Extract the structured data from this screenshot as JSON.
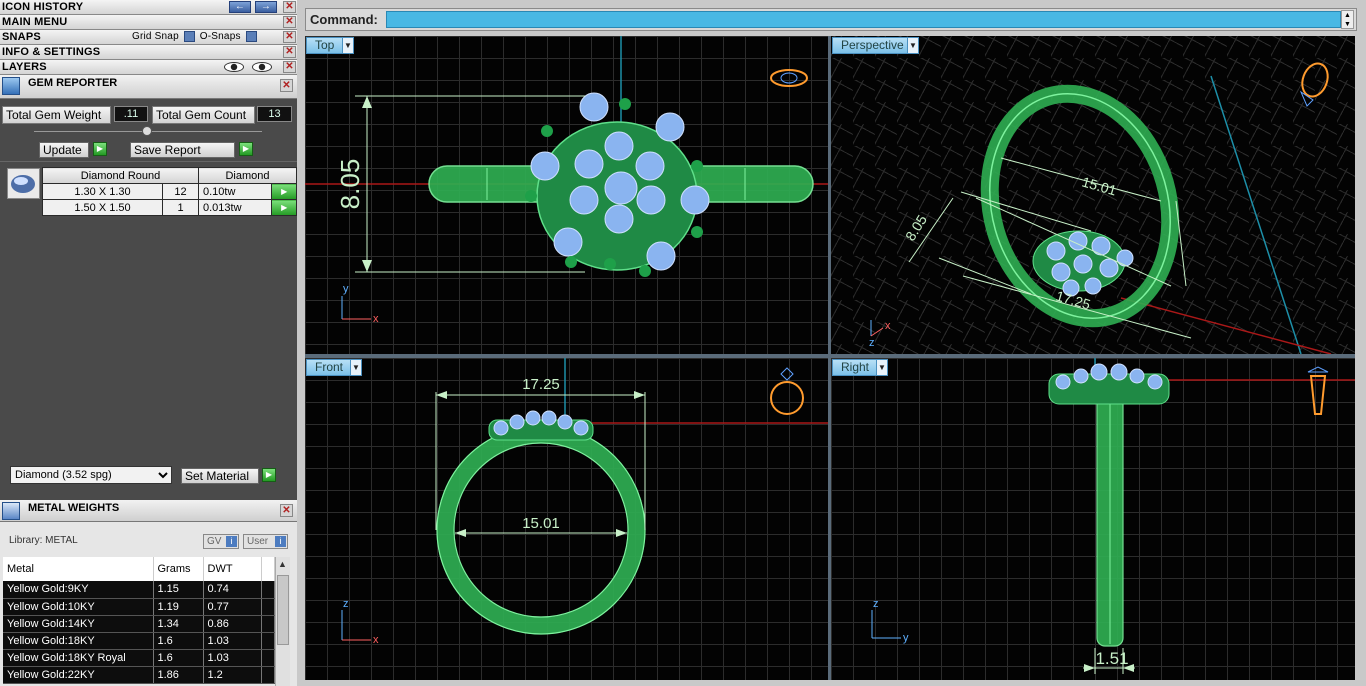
{
  "menus": {
    "icon_history": "ICON HISTORY",
    "main_menu": "MAIN MENU",
    "snaps": "SNAPS",
    "grid_snap": "Grid Snap",
    "o_snaps": "O-Snaps",
    "info_settings": "INFO & SETTINGS",
    "layers": "LAYERS"
  },
  "gem_reporter": {
    "title": "GEM REPORTER",
    "total_weight_label": "Total Gem Weight",
    "total_weight_value": ".11",
    "total_count_label": "Total Gem Count",
    "total_count_value": "13",
    "update_label": "Update",
    "save_label": "Save Report",
    "table_headers": [
      "Diamond Round",
      "Diamond"
    ],
    "rows": [
      {
        "size": "1.30 X 1.30",
        "count": "12",
        "weight": "0.10tw"
      },
      {
        "size": "1.50 X 1.50",
        "count": "1",
        "weight": "0.013tw"
      }
    ],
    "material_selected": "Diamond     (3.52 spg)",
    "set_material_label": "Set Material"
  },
  "metal_weights": {
    "title": "METAL WEIGHTS",
    "library": "Library: METAL",
    "gv": "GV",
    "user": "User",
    "headers": [
      "Metal",
      "Grams",
      "DWT"
    ],
    "rows": [
      {
        "metal": "Yellow Gold:9KY",
        "grams": "1.15",
        "dwt": "0.74"
      },
      {
        "metal": "Yellow Gold:10KY",
        "grams": "1.19",
        "dwt": "0.77"
      },
      {
        "metal": "Yellow Gold:14KY",
        "grams": "1.34",
        "dwt": "0.86"
      },
      {
        "metal": "Yellow Gold:18KY",
        "grams": "1.6",
        "dwt": "1.03"
      },
      {
        "metal": "Yellow Gold:18KY Royal",
        "grams": "1.6",
        "dwt": "1.03"
      },
      {
        "metal": "Yellow Gold:22KY",
        "grams": "1.86",
        "dwt": "1.2"
      }
    ]
  },
  "command": {
    "label": "Command:"
  },
  "viewports": {
    "top": {
      "label": "Top",
      "dim_height": "8.05",
      "axis_v": "y",
      "axis_h": "x"
    },
    "perspective": {
      "label": "Perspective",
      "dim_a": "15.01",
      "dim_b": "8.05",
      "dim_c": "17.25",
      "axis_v": "z",
      "axis_h": "x"
    },
    "front": {
      "label": "Front",
      "dim_outer": "17.25",
      "dim_inner": "15.01",
      "axis_v": "z",
      "axis_h": "x"
    },
    "right": {
      "label": "Right",
      "dim_width": "1.51",
      "axis_v": "z",
      "axis_h": "y"
    }
  },
  "colors": {
    "metal": "#3cc864",
    "gem": "#8ab4f0",
    "command_bar": "#49b8e4",
    "dimension": "#c8f0c8"
  }
}
